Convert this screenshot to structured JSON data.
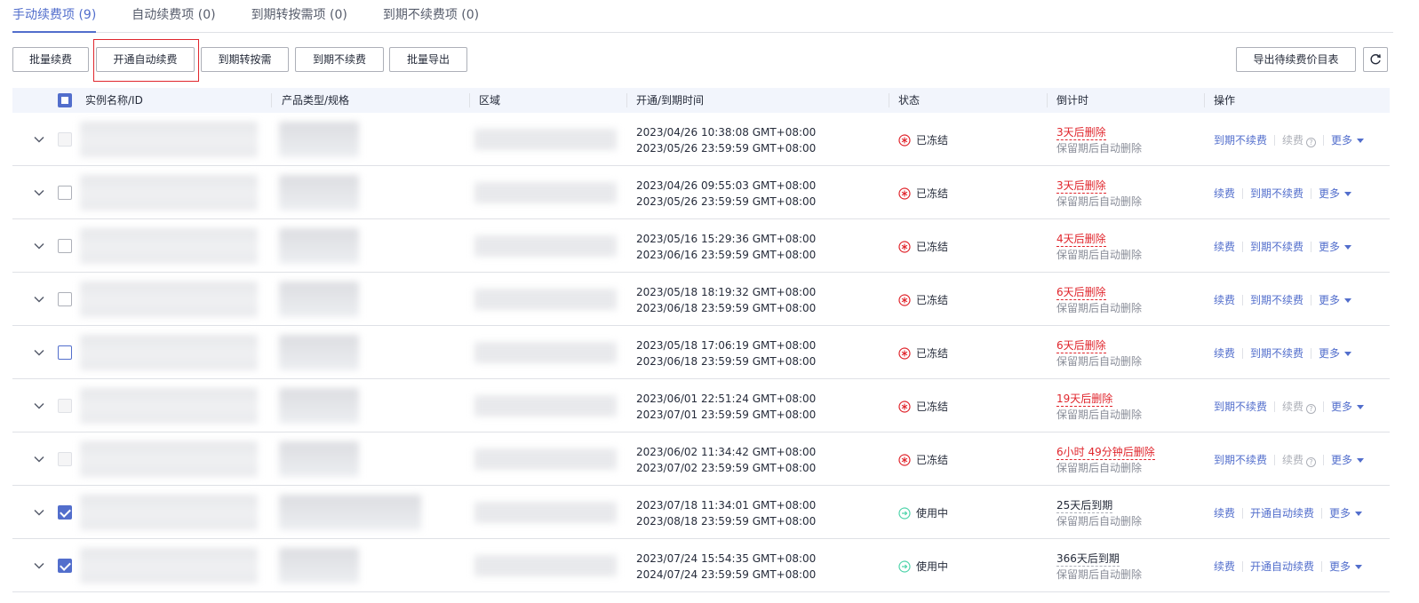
{
  "tabs": [
    {
      "label": "手动续费项 (9)",
      "active": true
    },
    {
      "label": "自动续费项 (0)",
      "active": false
    },
    {
      "label": "到期转按需项 (0)",
      "active": false
    },
    {
      "label": "到期不续费项 (0)",
      "active": false
    }
  ],
  "toolbar": {
    "batch_renew": "批量续费",
    "enable_auto_renew": "开通自动续费",
    "to_on_demand": "到期转按需",
    "no_renew": "到期不续费",
    "batch_export": "批量导出",
    "export_price_list": "导出待续费价目表",
    "refresh_icon": "refresh-icon"
  },
  "table": {
    "headers": {
      "name": "实例名称/ID",
      "type": "产品类型/规格",
      "region": "区域",
      "time": "开通/到期时间",
      "status": "状态",
      "countdown": "倒计时",
      "ops": "操作"
    },
    "rows": [
      {
        "checkbox": "disabled",
        "start": "2023/04/26 10:38:08 GMT+08:00",
        "end": "2023/05/26 23:59:59 GMT+08:00",
        "status": "已冻结",
        "countdown": "3天后删除",
        "countdown_red": true,
        "sub": "保留期后自动删除",
        "ops": [
          "到期不续费",
          "续费",
          "更多"
        ],
        "ops_style": "frozen-a"
      },
      {
        "checkbox": "normal",
        "start": "2023/04/26 09:55:03 GMT+08:00",
        "end": "2023/05/26 23:59:59 GMT+08:00",
        "status": "已冻结",
        "countdown": "3天后删除",
        "countdown_red": true,
        "sub": "保留期后自动删除",
        "ops": [
          "续费",
          "到期不续费",
          "更多"
        ],
        "ops_style": "frozen-b"
      },
      {
        "checkbox": "normal",
        "start": "2023/05/16 15:29:36 GMT+08:00",
        "end": "2023/06/16 23:59:59 GMT+08:00",
        "status": "已冻结",
        "countdown": "4天后删除",
        "countdown_red": true,
        "sub": "保留期后自动删除",
        "ops": [
          "续费",
          "到期不续费",
          "更多"
        ],
        "ops_style": "frozen-b"
      },
      {
        "checkbox": "normal",
        "start": "2023/05/18 18:19:32 GMT+08:00",
        "end": "2023/06/18 23:59:59 GMT+08:00",
        "status": "已冻结",
        "countdown": "6天后删除",
        "countdown_red": true,
        "sub": "保留期后自动删除",
        "ops": [
          "续费",
          "到期不续费",
          "更多"
        ],
        "ops_style": "frozen-b"
      },
      {
        "checkbox": "hover",
        "start": "2023/05/18 17:06:19 GMT+08:00",
        "end": "2023/06/18 23:59:59 GMT+08:00",
        "status": "已冻结",
        "countdown": "6天后删除",
        "countdown_red": true,
        "sub": "保留期后自动删除",
        "ops": [
          "续费",
          "到期不续费",
          "更多"
        ],
        "ops_style": "frozen-b"
      },
      {
        "checkbox": "disabled",
        "start": "2023/06/01 22:51:24 GMT+08:00",
        "end": "2023/07/01 23:59:59 GMT+08:00",
        "status": "已冻结",
        "countdown": "19天后删除",
        "countdown_red": true,
        "sub": "保留期后自动删除",
        "ops": [
          "到期不续费",
          "续费",
          "更多"
        ],
        "ops_style": "frozen-a"
      },
      {
        "checkbox": "disabled",
        "start": "2023/06/02 11:34:42 GMT+08:00",
        "end": "2023/07/02 23:59:59 GMT+08:00",
        "status": "已冻结",
        "countdown": "6小时 49分钟后删除",
        "countdown_red": true,
        "sub": "保留期后自动删除",
        "ops": [
          "到期不续费",
          "续费",
          "更多"
        ],
        "ops_style": "frozen-a"
      },
      {
        "checkbox": "checked",
        "start": "2023/07/18 11:34:01 GMT+08:00",
        "end": "2023/08/18 23:59:59 GMT+08:00",
        "status": "使用中",
        "countdown": "25天后到期",
        "countdown_red": false,
        "sub": "保留期后自动删除",
        "ops": [
          "续费",
          "开通自动续费",
          "更多"
        ],
        "ops_style": "active"
      },
      {
        "checkbox": "checked",
        "start": "2023/07/24 15:54:35 GMT+08:00",
        "end": "2024/07/24 23:59:59 GMT+08:00",
        "status": "使用中",
        "countdown": "366天后到期",
        "countdown_red": false,
        "sub": "保留期后自动删除",
        "ops": [
          "续费",
          "开通自动续费",
          "更多"
        ],
        "ops_style": "active"
      }
    ]
  },
  "colors": {
    "accent": "#526ecc",
    "danger": "#e0262d",
    "success": "#50d4ab",
    "header_bg": "#f2f5fc"
  }
}
